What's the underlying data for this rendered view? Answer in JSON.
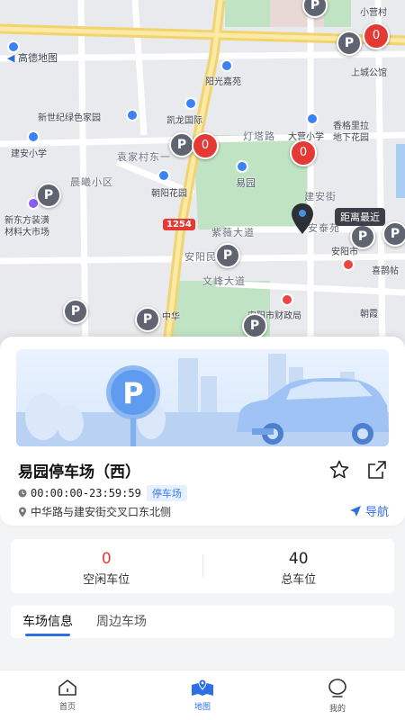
{
  "map": {
    "logo_text": "高德地图",
    "labels": {
      "xinshiji": "新世纪绿色家园",
      "kailong": "凯龙国际",
      "yangguang": "阳光嘉苑",
      "xiangge": "香格里拉",
      "dikhuayuan": "地下花园",
      "jianan_school": "建安小学",
      "yuanjia": "袁家村东一",
      "chenxi": "晨曦小区",
      "chaoyang": "朝阳花园",
      "xindongfang1": "新东方装潢",
      "xindongfang2": "材料大市场",
      "yiyuan": "易园",
      "jiananjie": "建安街",
      "ziwei": "紫薇大道",
      "anyang_minzheng": "安阳民政府",
      "wenfeng": "文峰大道",
      "anyang_caizheng": "安阳市财政局",
      "anyang_city": "安阳市",
      "xiquemiao": "喜鹊帖",
      "dengta": "灯塔路",
      "dayingxiaoxue": "大营小学",
      "xiaoyingcun": "小营村",
      "shangcheng": "上城公馆",
      "chaoxian": "朝霞",
      "antaiyuan": "安泰苑",
      "zhonghua": "中华"
    },
    "parking_pins": [
      "P",
      "P",
      "P",
      "P",
      "P",
      "P",
      "P",
      "P",
      "P",
      "P",
      "P",
      "P"
    ],
    "red_pin_values": [
      "0",
      "0",
      "0",
      "0"
    ],
    "road_badge": "1254",
    "nearest_tag": "距离最近"
  },
  "card": {
    "lot_name": "易园停车场（西）",
    "hours": "00:00:00-23:59:59",
    "lot_type": "停车场",
    "address": "中华路与建安街交叉口东北侧",
    "nav_label": "导航"
  },
  "stats": {
    "free_value": "0",
    "free_label": "空闲车位",
    "total_value": "40",
    "total_label": "总车位"
  },
  "tabs": [
    {
      "label": "车场信息",
      "active": true
    },
    {
      "label": "周边车场",
      "active": false
    }
  ],
  "bottom_nav": [
    {
      "label": "首页",
      "icon": "home-icon",
      "active": false
    },
    {
      "label": "地图",
      "icon": "map-icon",
      "active": true
    },
    {
      "label": "我的",
      "icon": "profile-icon",
      "active": false
    }
  ],
  "colors": {
    "accent": "#2f6fe6",
    "free_value": "#e53935",
    "park_green": "#bfe3c3",
    "main_road": "#f7d36b",
    "pin_gray": "#5f6470",
    "pin_red": "#e53935"
  }
}
